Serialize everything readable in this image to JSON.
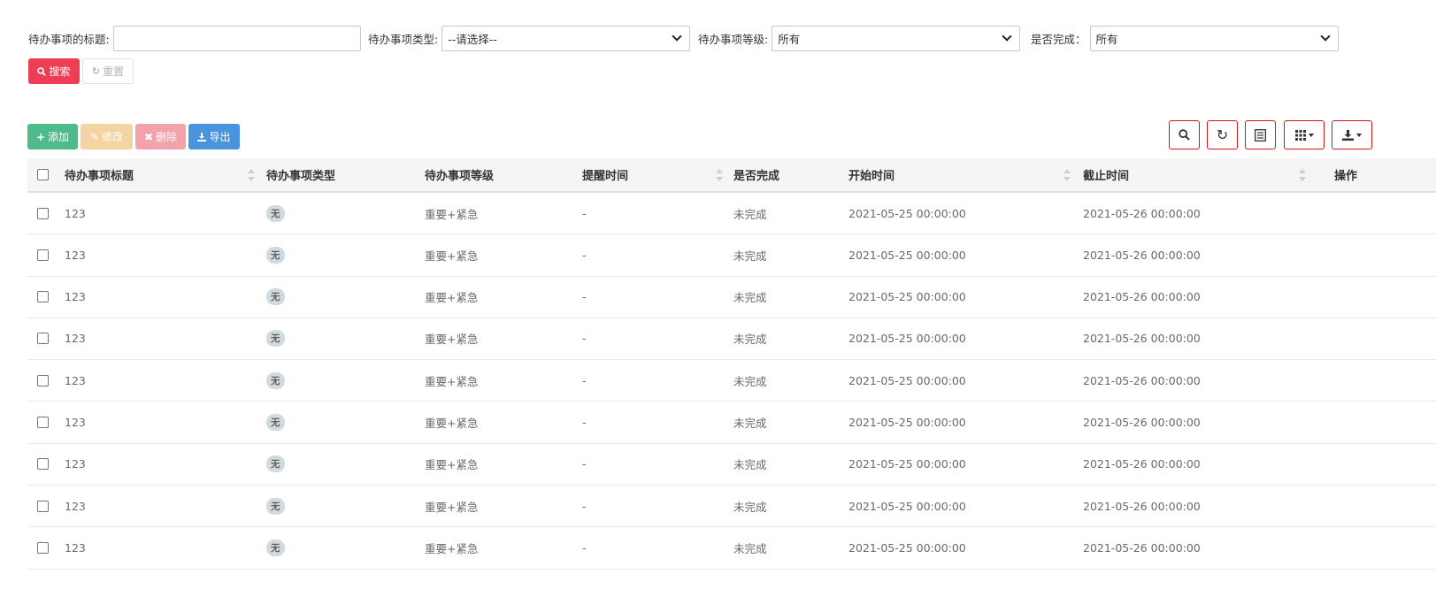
{
  "search": {
    "title_label": "待办事项的标题:",
    "title_value": "",
    "type_label": "待办事项类型:",
    "type_value": "--请选择--",
    "level_label": "待办事项等级:",
    "level_value": "所有",
    "done_label": "是否完成：",
    "done_value": "所有",
    "search_button": "搜索",
    "reset_button": "重置"
  },
  "toolbar": {
    "add": "添加",
    "edit": "修改",
    "delete": "删除",
    "export": "导出"
  },
  "table": {
    "headers": {
      "title": "待办事项标题",
      "type": "待办事项类型",
      "level": "待办事项等级",
      "remind": "提醒时间",
      "done": "是否完成",
      "start": "开始时间",
      "end": "截止时间",
      "op": "操作"
    },
    "rows": [
      {
        "title": "123",
        "type": "无",
        "level": "重要+紧急",
        "remind": "-",
        "done": "未完成",
        "start": "2021-05-25 00:00:00",
        "end": "2021-05-26 00:00:00"
      },
      {
        "title": "123",
        "type": "无",
        "level": "重要+紧急",
        "remind": "-",
        "done": "未完成",
        "start": "2021-05-25 00:00:00",
        "end": "2021-05-26 00:00:00"
      },
      {
        "title": "123",
        "type": "无",
        "level": "重要+紧急",
        "remind": "-",
        "done": "未完成",
        "start": "2021-05-25 00:00:00",
        "end": "2021-05-26 00:00:00"
      },
      {
        "title": "123",
        "type": "无",
        "level": "重要+紧急",
        "remind": "-",
        "done": "未完成",
        "start": "2021-05-25 00:00:00",
        "end": "2021-05-26 00:00:00"
      },
      {
        "title": "123",
        "type": "无",
        "level": "重要+紧急",
        "remind": "-",
        "done": "未完成",
        "start": "2021-05-25 00:00:00",
        "end": "2021-05-26 00:00:00"
      },
      {
        "title": "123",
        "type": "无",
        "level": "重要+紧急",
        "remind": "-",
        "done": "未完成",
        "start": "2021-05-25 00:00:00",
        "end": "2021-05-26 00:00:00"
      },
      {
        "title": "123",
        "type": "无",
        "level": "重要+紧急",
        "remind": "-",
        "done": "未完成",
        "start": "2021-05-25 00:00:00",
        "end": "2021-05-26 00:00:00"
      },
      {
        "title": "123",
        "type": "无",
        "level": "重要+紧急",
        "remind": "-",
        "done": "未完成",
        "start": "2021-05-25 00:00:00",
        "end": "2021-05-26 00:00:00"
      },
      {
        "title": "123",
        "type": "无",
        "level": "重要+紧急",
        "remind": "-",
        "done": "未完成",
        "start": "2021-05-25 00:00:00",
        "end": "2021-05-26 00:00:00"
      }
    ]
  },
  "icons": {
    "search_button_icon": "search-icon",
    "reset_button_icon": "refresh-icon",
    "add_icon": "plus-icon",
    "edit_icon": "edit-icon",
    "delete_icon": "times-icon",
    "export_icon": "download-icon",
    "table_search": "search-icon",
    "table_refresh": "refresh-icon",
    "table_toggle": "list-icon",
    "table_columns": "grid-icon",
    "table_export": "download-icon"
  },
  "colors": {
    "search_button": "#ed3e55",
    "add_button": "#4ebb8d",
    "edit_button": "#f5d4a3",
    "delete_button": "#f2a2ab",
    "export_button": "#4a93dd",
    "tool_border": "#d2141c"
  }
}
